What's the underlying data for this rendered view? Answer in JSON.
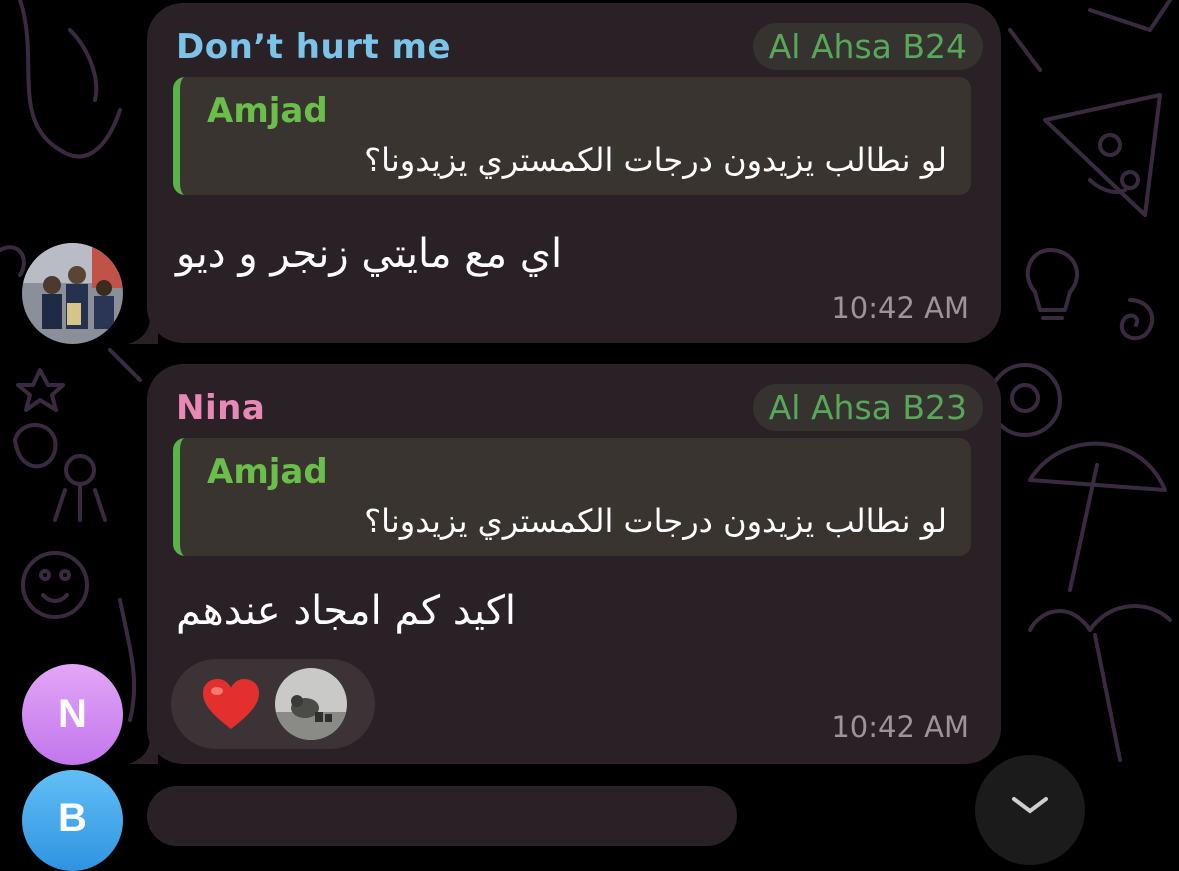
{
  "colors": {
    "background": "#000000",
    "bubble": "#2a2127",
    "tag_bg": "#363230",
    "tag_text": "#58a85a",
    "quote_bar": "#5bb14a",
    "quote_author": "#6abf4b",
    "time": "#9c9498"
  },
  "messages": [
    {
      "sender": "Don’t hurt me",
      "sender_color": "#7cc3ea",
      "tag": "Al Ahsa B24",
      "reply": {
        "author": "Amjad",
        "text": "لو نطالب يزيدون درجات الكمستري يزيدونا؟"
      },
      "text": "اي مع مايتي زنجر و ديو",
      "time": "10:42 AM",
      "avatar": {
        "type": "photo",
        "icon": "group-photo-avatar"
      }
    },
    {
      "sender": "Nina",
      "sender_color": "#e889b5",
      "tag": "Al Ahsa B23",
      "reply": {
        "author": "Amjad",
        "text": "لو نطالب يزيدون درجات الكمستري يزيدونا؟"
      },
      "text": "اكيد كم امجاد عندهم",
      "time": "10:42 AM",
      "reactions": [
        {
          "emoji": "❤️",
          "icon": "red-heart-icon"
        },
        {
          "icon": "reactor-avatar"
        }
      ],
      "avatar": {
        "type": "initial",
        "initial": "N",
        "color": "#d28bf2"
      }
    }
  ],
  "next_avatar": {
    "initial": "B",
    "color": "#3aa3e8"
  }
}
